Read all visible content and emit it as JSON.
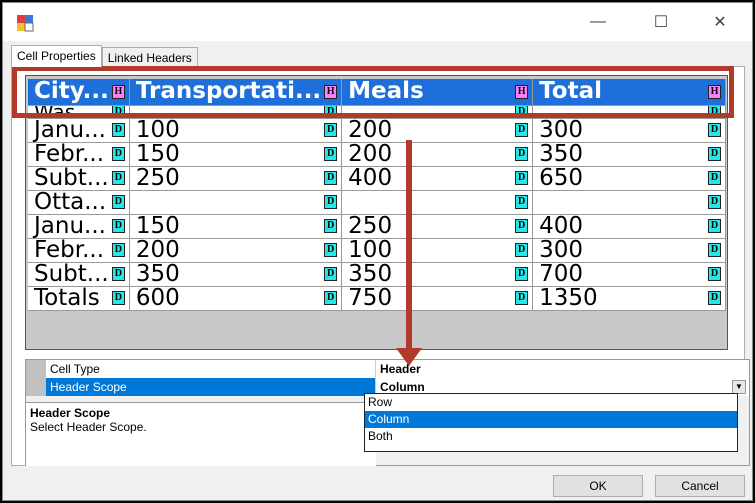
{
  "window": {
    "minimize_glyph": "—",
    "maximize_glyph": "☐",
    "close_glyph": "✕"
  },
  "tabs": [
    {
      "label": "Cell Properties"
    },
    {
      "label": "Linked Headers"
    }
  ],
  "grid": {
    "header": [
      {
        "text": "City...",
        "badge": "H"
      },
      {
        "text": "Transportati...",
        "badge": "H"
      },
      {
        "text": "Meals",
        "badge": "H"
      },
      {
        "text": "Total",
        "badge": "H"
      }
    ],
    "rows": [
      [
        "Was...",
        "",
        "",
        ""
      ],
      [
        "Janu...",
        "100",
        "200",
        "300"
      ],
      [
        "Febr...",
        "150",
        "200",
        "350"
      ],
      [
        "Subt...",
        "250",
        "400",
        "650"
      ],
      [
        "Otta...",
        "",
        "",
        ""
      ],
      [
        "Janu...",
        "150",
        "250",
        "400"
      ],
      [
        "Febr...",
        "200",
        "100",
        "300"
      ],
      [
        "Subt...",
        "350",
        "350",
        "700"
      ],
      [
        "Totals",
        "600",
        "750",
        "1350"
      ]
    ],
    "cell_badge": "D"
  },
  "properties": {
    "cell_type": {
      "name": "Cell Type",
      "value": "Header"
    },
    "header_scope": {
      "name": "Header Scope",
      "value": "Column"
    }
  },
  "help": {
    "title": "Header Scope",
    "text": "Select Header Scope."
  },
  "dropdown": {
    "options": [
      "Row",
      "Column",
      "Both"
    ],
    "selected": "Column"
  },
  "buttons": {
    "ok": "OK",
    "cancel": "Cancel"
  },
  "colors": {
    "header_bg": "#1e6fd9",
    "h_badge": "#ff80ff",
    "d_badge": "#27e6e6",
    "annotation": "#b23a2a",
    "selection": "#0078d7"
  }
}
